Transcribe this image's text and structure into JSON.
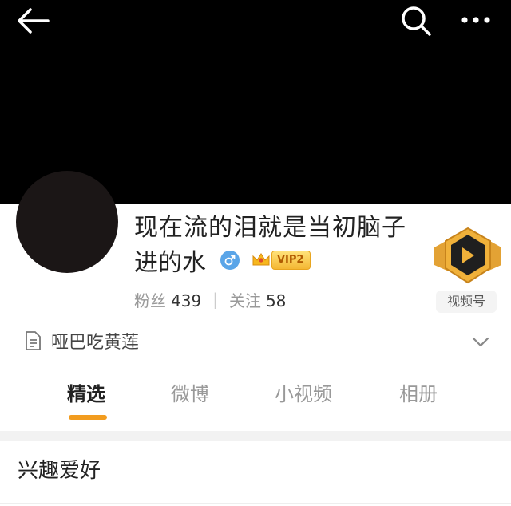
{
  "header": {
    "icons": [
      "back-arrow-icon",
      "search-icon",
      "more-icon"
    ]
  },
  "profile": {
    "name_line1": "现在流的泪就是当初脑子",
    "name_line2": "进的水",
    "gender_icon": "male-icon",
    "vip_label": "VIP2",
    "followers_label": "粉丝",
    "followers_count": "439",
    "following_label": "关注",
    "following_count": "58",
    "channel_label": "视频号",
    "bio": "哑巴吃黄莲"
  },
  "tabs": [
    {
      "label": "精选",
      "active": true
    },
    {
      "label": "微博",
      "active": false
    },
    {
      "label": "小视频",
      "active": false
    },
    {
      "label": "相册",
      "active": false
    }
  ],
  "sections": {
    "first_title": "兴趣爱好"
  },
  "colors": {
    "accent": "#f29c1f",
    "cover": "#000000",
    "gender": "#5aa5e8"
  }
}
